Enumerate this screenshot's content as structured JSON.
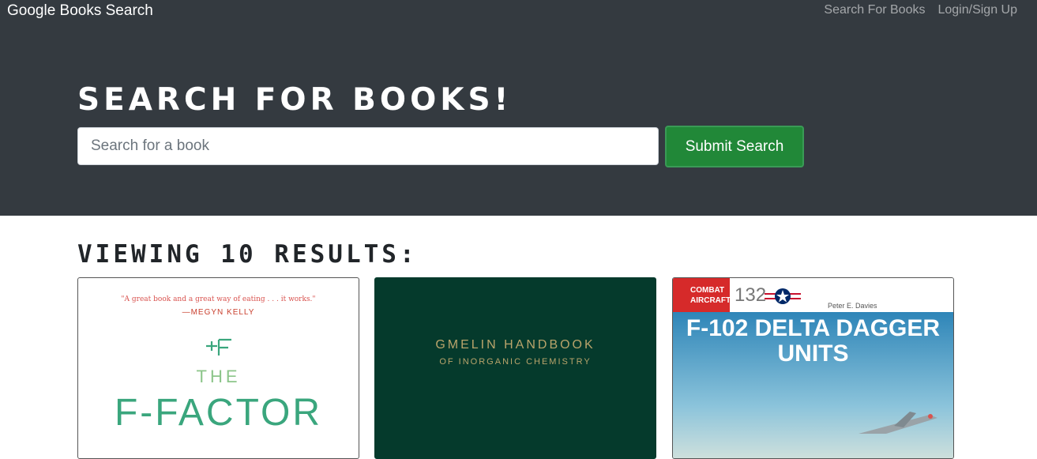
{
  "navbar": {
    "brand": "Google Books Search",
    "links": [
      "Search For Books",
      "Login/Sign Up"
    ]
  },
  "hero": {
    "title": "SEARCH FOR BOOKS!",
    "search_placeholder": "Search for a book",
    "submit_label": "Submit Search"
  },
  "results": {
    "title": "VIEWING 10 RESULTS:"
  },
  "cards": [
    {
      "quote": "\"A great book and a great way of eating . . . it works.\"",
      "quote_author": "—MEGYN KELLY",
      "title_small": "THE",
      "title_large": "F-FACTOR"
    },
    {
      "title": "GMELIN HANDBOOK",
      "subtitle": "OF INORGANIC CHEMISTRY"
    },
    {
      "series": "COMBAT AIRCRAFT",
      "series_number": "132",
      "author": "Peter E. Davies",
      "title": "F-102 DELTA DAGGER UNITS"
    }
  ],
  "colors": {
    "header_bg": "#343a40",
    "submit_bg": "#218838"
  }
}
